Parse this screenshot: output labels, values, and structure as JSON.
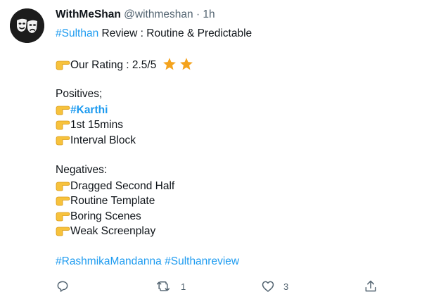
{
  "author": {
    "name": "WithMeShan",
    "handle": "@withmeshan",
    "separator": "·",
    "time": "1h"
  },
  "tweet": {
    "title_hashtag": "#Sulthan",
    "title_rest": " Review : Routine & Predictable",
    "rating": "Our Rating : 2.5/5",
    "positives_heading": "Positives;",
    "positives": [
      {
        "text": "#Karthi",
        "hashtag": true
      },
      {
        "text": "1st 15mins",
        "hashtag": false
      },
      {
        "text": "Interval Block",
        "hashtag": false
      }
    ],
    "negatives_heading": "Negatives:",
    "negatives": [
      {
        "text": "Dragged Second Half"
      },
      {
        "text": "Routine Template"
      },
      {
        "text": "Boring Scenes"
      },
      {
        "text": "Weak Screenplay"
      }
    ],
    "hashtags": [
      "#RashmikaMandanna",
      "#Sulthanreview"
    ]
  },
  "actions": {
    "reply_count": "",
    "retweet_count": "1",
    "like_count": "3"
  },
  "colors": {
    "accent": "#1d9bf0",
    "star": "#f4a31d",
    "muted": "#536471"
  },
  "icons": [
    "drama-masks-avatar",
    "pointing-hand-icon",
    "star-icon",
    "reply-icon",
    "retweet-icon",
    "like-icon",
    "share-icon"
  ]
}
